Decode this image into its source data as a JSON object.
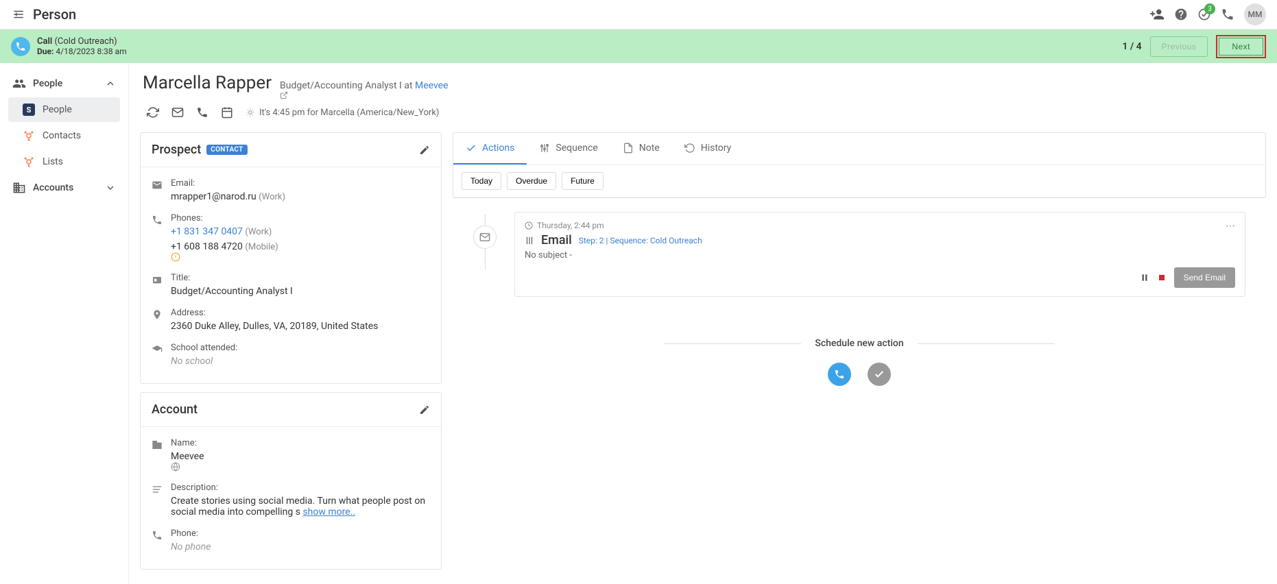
{
  "topbar": {
    "title": "Person",
    "badge": "3",
    "avatar": "MM"
  },
  "banner": {
    "title": "Call",
    "context": "(Cold Outreach)",
    "due_label": "Due:",
    "due": "4/18/2023 8:38 am",
    "counter": "1 / 4",
    "prev": "Previous",
    "next": "Next"
  },
  "sidebar": {
    "people": "People",
    "people_item": "People",
    "contacts": "Contacts",
    "lists": "Lists",
    "accounts": "Accounts"
  },
  "person": {
    "name": "Marcella Rapper",
    "role_prefix": "Budget/Accounting Analyst I at ",
    "company": "Meevee",
    "time": "It's 4:45 pm for Marcella (America/New_York)"
  },
  "prospect": {
    "title": "Prospect",
    "badge": "CONTACT",
    "email_label": "Email:",
    "email": "mrapper1@narod.ru",
    "email_meta": "(Work)",
    "phones_label": "Phones:",
    "phone1": "+1 831 347 0407",
    "phone1_meta": "(Work)",
    "phone2": "+1 608 188 4720",
    "phone2_meta": "(Mobile)",
    "title_label": "Title:",
    "title_value": "Budget/Accounting Analyst I",
    "address_label": "Address:",
    "address_value": "2360 Duke Alley, Dulles, VA, 20189, United States",
    "school_label": "School attended:",
    "school_value": "No school"
  },
  "account": {
    "title": "Account",
    "name_label": "Name:",
    "name_value": "Meevee",
    "desc_label": "Description:",
    "desc_value": "Create stories using social media. Turn what people post on social media into compelling s",
    "show_more": "show more..",
    "phone_label": "Phone:",
    "phone_value": "No phone"
  },
  "tabs": {
    "actions": "Actions",
    "sequence": "Sequence",
    "note": "Note",
    "history": "History"
  },
  "filters": {
    "today": "Today",
    "overdue": "Overdue",
    "future": "Future"
  },
  "action": {
    "time": "Thursday, 2:44 pm",
    "title": "Email",
    "step": "Step: 2 | Sequence: Cold Outreach",
    "subject": "No subject -",
    "send": "Send Email"
  },
  "schedule": {
    "title": "Schedule new action"
  }
}
